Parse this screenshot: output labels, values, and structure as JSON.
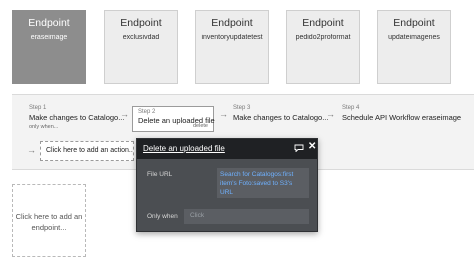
{
  "endpoints": [
    {
      "title": "Endpoint",
      "name": "eraseimage"
    },
    {
      "title": "Endpoint",
      "name": "exclusivdad"
    },
    {
      "title": "Endpoint",
      "name": "inventoryupdatetest"
    },
    {
      "title": "Endpoint",
      "name": "pedido2proformat"
    },
    {
      "title": "Endpoint",
      "name": "updateimagenes"
    }
  ],
  "steps": [
    {
      "number": "Step 1",
      "name": "Make changes to Catalogo...",
      "sub": "only when..."
    },
    {
      "number": "Step 2",
      "name": "Delete an uploaded file",
      "sub": "delete"
    },
    {
      "number": "Step 3",
      "name": "Make changes to Catalogo...",
      "sub": ""
    },
    {
      "number": "Step 4",
      "name": "Schedule API Workflow eraseimage",
      "sub": ""
    }
  ],
  "add_action": "Click here to add an action...",
  "add_endpoint": [
    "Click here to add an",
    "endpoint..."
  ],
  "panel": {
    "title": "Delete an uploaded file",
    "file_url_label": "File URL",
    "file_url_value": [
      "Search for Catalogos:first",
      "item's Foto:saved to S3's",
      "URL"
    ],
    "only_when_label": "Only when",
    "only_when_placeholder": "Click"
  },
  "icons": {
    "comment": "comment-icon",
    "close": "close-icon",
    "arrow": "arrow-right-icon"
  },
  "colors": {
    "active_endpoint": "#8d8d8d",
    "panel_bg": "#4b4e52",
    "panel_header": "#1f2124",
    "link_blue": "#6fb1ff"
  }
}
